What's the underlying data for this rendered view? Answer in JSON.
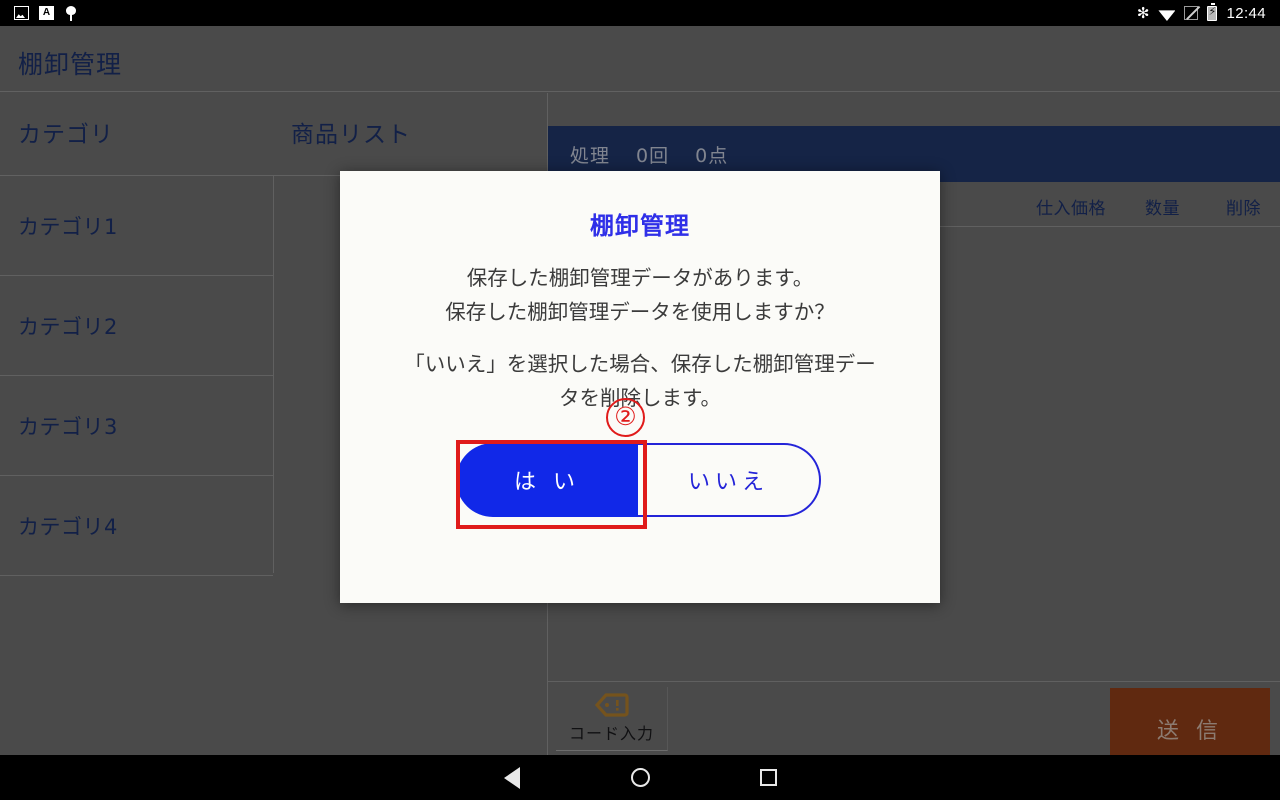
{
  "statusbar": {
    "icons_left": [
      "image-icon",
      "input-method-icon",
      "bug-report-icon"
    ],
    "icons_right": [
      "bluetooth-icon",
      "wifi-icon",
      "signal-off-icon",
      "battery-charging-icon"
    ],
    "clock": "12:44"
  },
  "app": {
    "title": "棚卸管理"
  },
  "columns": {
    "category_header": "カテゴリ",
    "product_list_header": "商品リスト"
  },
  "categories": [
    {
      "label": "カテゴリ1"
    },
    {
      "label": "カテゴリ2"
    },
    {
      "label": "カテゴリ3"
    },
    {
      "label": "カテゴリ4"
    }
  ],
  "process_bar": {
    "label": "処理",
    "count": "0回",
    "items": "0点"
  },
  "table_headers": {
    "price": "仕入価格",
    "quantity": "数量",
    "delete": "削除"
  },
  "toolbar": {
    "code_input_label": "コード入力",
    "code_input_icon": "tag-icon",
    "send_label": "送 信"
  },
  "dialog": {
    "title": "棚卸管理",
    "line1": "保存した棚卸管理データがあります。",
    "line2": "保存した棚卸管理データを使用しますか？",
    "line3": "「いいえ」を選択した場合、保存した棚卸管理デー",
    "line4": "タを削除します。",
    "yes_label": "は い",
    "no_label": "いいえ"
  },
  "annotation": {
    "step_number": "②",
    "color": "#e01b1b",
    "target": "yes-button"
  },
  "navbar": {
    "back": "back-icon",
    "home": "home-icon",
    "recents": "recents-icon"
  },
  "colors": {
    "app_background": "#6a6a6a",
    "title_text": "#1b2f66",
    "process_bar": "#1f3465",
    "dialog_background": "#fbfbf8",
    "dialog_title": "#2f2fe8",
    "primary_button": "#1128e8",
    "send_button": "#8a3c17",
    "annotation_red": "#e01b1b"
  }
}
